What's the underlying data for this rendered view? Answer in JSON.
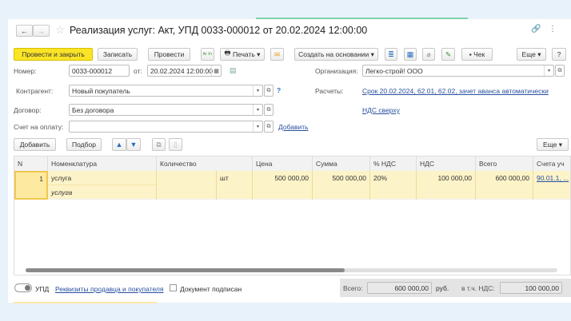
{
  "title": "Реализация услуг: Акт, УПД 0033-000012 от 20.02.2024 12:00:00",
  "toolbar": {
    "post_close": "Провести и закрыть",
    "save": "Записать",
    "post": "Провести",
    "dtkt": "Ат Кт",
    "print": "Печать",
    "create_based": "Создать на основании",
    "check": "Чек",
    "more": "Еще",
    "help": "?"
  },
  "form": {
    "number_label": "Номер:",
    "number": "0033-000012",
    "date_label": "от:",
    "date": "20.02.2024 12:00:00",
    "org_label": "Организация:",
    "org": "Легко-строй! ООО",
    "counterparty_label": "Контрагент:",
    "counterparty": "Новый покупатель",
    "help": "?",
    "settlements_label": "Расчеты:",
    "settlements_link": "Срок 20.02.2024, 62.01, 62.02, зачет аванса автоматически",
    "contract_label": "Договор:",
    "contract": "Без договора",
    "vat_link": "НДС сверху",
    "invoice_label": "Счет на оплату:",
    "invoice": "",
    "invoice_add": "Добавить"
  },
  "table_toolbar": {
    "add": "Добавить",
    "pick": "Подбор",
    "more": "Еще"
  },
  "table": {
    "headers": [
      "N",
      "Номенклатура",
      "Количество",
      "Цена",
      "Сумма",
      "% НДС",
      "НДС",
      "Всего",
      "Счета уч"
    ],
    "rows": [
      {
        "n": "1",
        "item": "услуга",
        "item_sub": "услуга",
        "qty": "",
        "unit": "шт",
        "price": "500 000,00",
        "sum": "500 000,00",
        "vat_rate": "20%",
        "vat": "100 000,00",
        "total": "600 000,00",
        "accounts": "90.01.1, ..."
      }
    ]
  },
  "footer": {
    "upd": "УПД",
    "requisites_link": "Реквизиты продавца и покупателя",
    "signed": "Документ подписан",
    "total_label": "Всего:",
    "total": "600 000,00",
    "currency": "руб.",
    "vat_label": "в т.ч. НДС:",
    "vat": "100 000,00"
  },
  "colors": {
    "accent": "#fbe426",
    "link": "#2850a0",
    "row_selected": "#fdf3c8"
  }
}
